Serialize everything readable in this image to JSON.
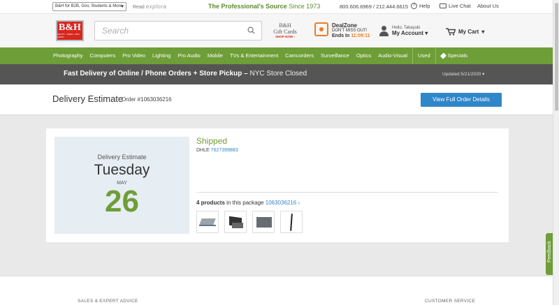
{
  "topbar": {
    "b2b_label": "B&H for B2B, Gov, Students & More",
    "read_label": "Read",
    "explora_label": "explora",
    "tagline_main": "The Professional's Source",
    "tagline_since": "Since 1973",
    "phones": "800.606.6969 / 212.444.6615",
    "help": "Help",
    "live_chat": "Live Chat",
    "about": "About Us"
  },
  "header": {
    "logo_text": "B&H",
    "logo_sub": "PHOTO · VIDEO · PRO AUDIO",
    "search_placeholder": "Search",
    "giftcards_line1": "B&H",
    "giftcards_line2": "Gift Cards",
    "giftcards_cta": "SHOP NOW ›",
    "dealzone_title": "DealZone",
    "dealzone_sub": "DON'T MISS OUT!",
    "dealzone_ends": "Ends In",
    "dealzone_time": "11:09:11",
    "account_greeting": "Hello, Takayuki",
    "account_label": "My Account",
    "cart_label": "My Cart"
  },
  "nav": {
    "items": [
      "Photography",
      "Computers",
      "Pro Video",
      "Lighting",
      "Pro Audio",
      "Mobile",
      "TVs & Entertainment",
      "Camcorders",
      "Surveillance",
      "Optics",
      "Audio-Visual",
      "Used",
      "Specials"
    ]
  },
  "banner": {
    "message": "Fast Delivery of Online / Phone Orders + Store Pickup –",
    "store_status": "NYC Store Closed",
    "updated": "Updated 5/21/2020"
  },
  "page": {
    "title": "Delivery Estimate",
    "order": "Order #1063036216",
    "view_button": "View Full Order Details"
  },
  "estimate": {
    "label": "Delivery Estimate",
    "day": "Tuesday",
    "month": "MAY",
    "date": "26"
  },
  "shipment": {
    "status": "Shipped",
    "carrier": "DHLE",
    "tracking": "7627399883",
    "product_count": "4 products",
    "package_text": "in this package",
    "package_id": "1063036216 ›"
  },
  "footer": {
    "col1": "SALES & EXPERT ADVICE",
    "col2": "CUSTOMER SERVICE"
  },
  "feedback_label": "Feedback",
  "colors": {
    "brand_green": "#6e9e37",
    "brand_red": "#d9261c",
    "link_blue": "#2f86c9",
    "banner_gray": "#555555"
  }
}
